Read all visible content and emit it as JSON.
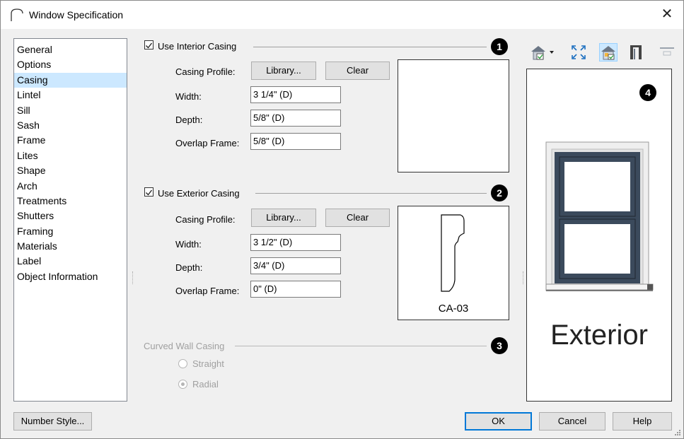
{
  "window": {
    "title": "Window Specification",
    "close_glyph": "✕"
  },
  "nav": {
    "items": [
      {
        "label": "General"
      },
      {
        "label": "Options"
      },
      {
        "label": "Casing"
      },
      {
        "label": "Lintel"
      },
      {
        "label": "Sill"
      },
      {
        "label": "Sash"
      },
      {
        "label": "Frame"
      },
      {
        "label": "Lites"
      },
      {
        "label": "Shape"
      },
      {
        "label": "Arch"
      },
      {
        "label": "Treatments"
      },
      {
        "label": "Shutters"
      },
      {
        "label": "Framing"
      },
      {
        "label": "Materials"
      },
      {
        "label": "Label"
      },
      {
        "label": "Object Information"
      }
    ],
    "selected": "Casing"
  },
  "interior": {
    "checkbox_label": "Use Interior Casing",
    "checked": true,
    "badge": "1",
    "profile_label": "Casing Profile:",
    "library_button": "Library...",
    "clear_button": "Clear",
    "width_label": "Width:",
    "width_value": "3 1/4\" (D)",
    "depth_label": "Depth:",
    "depth_value": "5/8\" (D)",
    "overlap_label": "Overlap Frame:",
    "overlap_value": "5/8\" (D)",
    "profile_name": ""
  },
  "exterior": {
    "checkbox_label": "Use Exterior Casing",
    "checked": true,
    "badge": "2",
    "profile_label": "Casing Profile:",
    "library_button": "Library...",
    "clear_button": "Clear",
    "width_label": "Width:",
    "width_value": "3 1/2\" (D)",
    "depth_label": "Depth:",
    "depth_value": "3/4\" (D)",
    "overlap_label": "Overlap Frame:",
    "overlap_value": "0\" (D)",
    "profile_name": "CA-03"
  },
  "curved": {
    "label": "Curved Wall Casing",
    "badge": "3",
    "options": [
      {
        "label": "Straight",
        "selected": false
      },
      {
        "label": "Radial",
        "selected": true
      }
    ],
    "enabled": false
  },
  "preview": {
    "badge": "4",
    "view_label": "Exterior",
    "tools": [
      "camera-view-icon",
      "fill-window-icon",
      "view-materials-icon",
      "opening-icon",
      "hide-icon"
    ]
  },
  "footer": {
    "number_style_button": "Number Style...",
    "ok_button": "OK",
    "cancel_button": "Cancel",
    "help_button": "Help"
  },
  "colors": {
    "selection": "#cce8ff",
    "accent": "#0078d7",
    "window_frame": "#3b4a5c",
    "trim": "#ededed"
  }
}
